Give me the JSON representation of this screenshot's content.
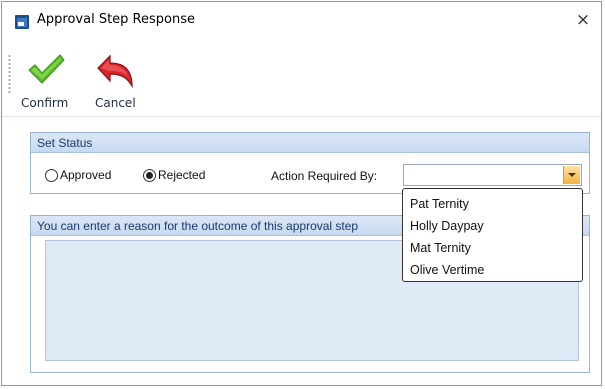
{
  "window": {
    "title": "Approval Step Response",
    "close_glyph": "×"
  },
  "toolbar": {
    "confirm_label": "Confirm",
    "cancel_label": "Cancel",
    "confirm_icon": "checkmark-icon",
    "cancel_icon": "undo-arrow-icon"
  },
  "set_status": {
    "header": "Set Status",
    "options": [
      {
        "label": "Approved",
        "checked": false
      },
      {
        "label": "Rejected",
        "checked": true
      }
    ],
    "action_required_label": "Action Required By:",
    "action_required_value": "",
    "dropdown_options": [
      "Pat Ternity",
      "Holly Daypay",
      "Mat Ternity",
      "Olive Vertime"
    ]
  },
  "reason": {
    "header": "You can enter a reason for the outcome of this approval step",
    "value": ""
  },
  "colors": {
    "accent_border": "#98b3d6",
    "header_text": "#1a3a6b",
    "combo_button": "#f6b042"
  }
}
